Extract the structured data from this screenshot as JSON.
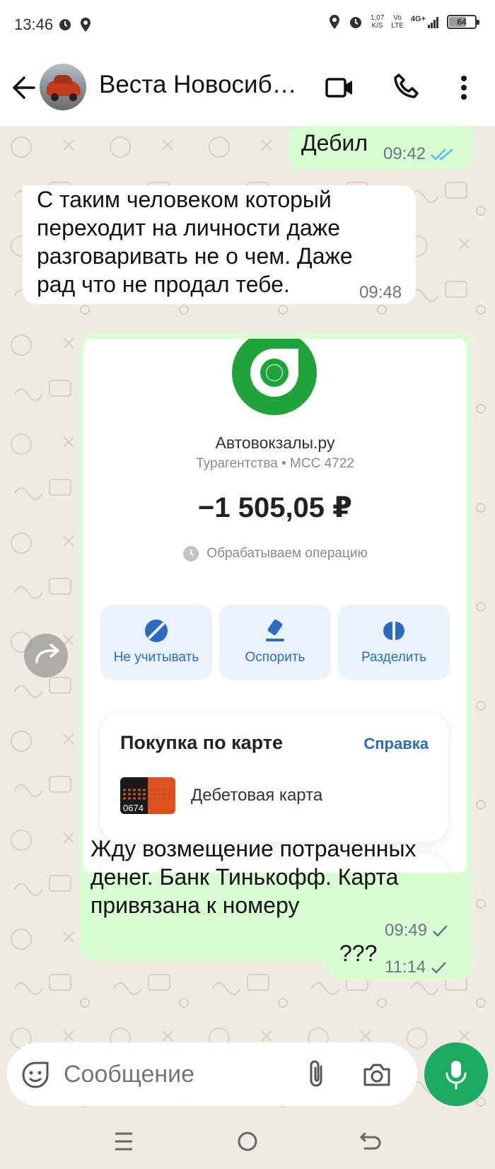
{
  "status_bar": {
    "time": "13:46",
    "speed_value": "1,07",
    "speed_unit": "K/S",
    "volte_top": "Vo",
    "volte_bottom": "LTE",
    "network": "4G+",
    "battery": "64"
  },
  "header": {
    "title": "Веста Новосиб…"
  },
  "messages": [
    {
      "direction": "outgoing",
      "text": "Дебил",
      "time": "09:42",
      "status": "read"
    },
    {
      "direction": "incoming",
      "text": "С таким человеком который переходит на личности даже разговаривать не о чем. Даже рад что не продал тебе.",
      "time": "09:48"
    },
    {
      "direction": "outgoing",
      "type": "image_with_caption",
      "caption": "Жду возмещение потраченных денег. Банк Тинькофф. Карта привязана к номеру",
      "time": "09:49",
      "status": "sent",
      "screenshot": {
        "merchant_name": "Автовокзалы.ру",
        "merchant_category": "Турагентства • MCC 4722",
        "amount": "−1 505,05 ₽",
        "status_text": "Обрабатываем операцию",
        "actions": [
          "Не учитывать",
          "Оспорить",
          "Разделить"
        ],
        "card_title": "Покупка по карте",
        "card_link": "Справка",
        "card_number": "0674",
        "card_name": "Дебетовая карта",
        "brand_color": "#1fa33a",
        "accent_color": "#2c6bbf"
      }
    },
    {
      "direction": "outgoing",
      "text": "???",
      "time": "11:14",
      "status": "sent"
    }
  ],
  "input": {
    "placeholder": "Сообщение"
  },
  "colors": {
    "outgoing_bubble": "#d9fdd3",
    "incoming_bubble": "#ffffff",
    "chat_background": "#efeae2",
    "mic_button": "#1daa61",
    "read_ticks": "#53bdeb"
  },
  "icons": [
    "alarm-icon",
    "location-icon",
    "back-arrow-icon",
    "video-call-icon",
    "phone-icon",
    "more-vert-icon",
    "forward-icon",
    "sticker-icon",
    "attach-icon",
    "camera-icon",
    "mic-icon",
    "menu-nav-icon",
    "home-nav-icon",
    "back-nav-icon"
  ]
}
